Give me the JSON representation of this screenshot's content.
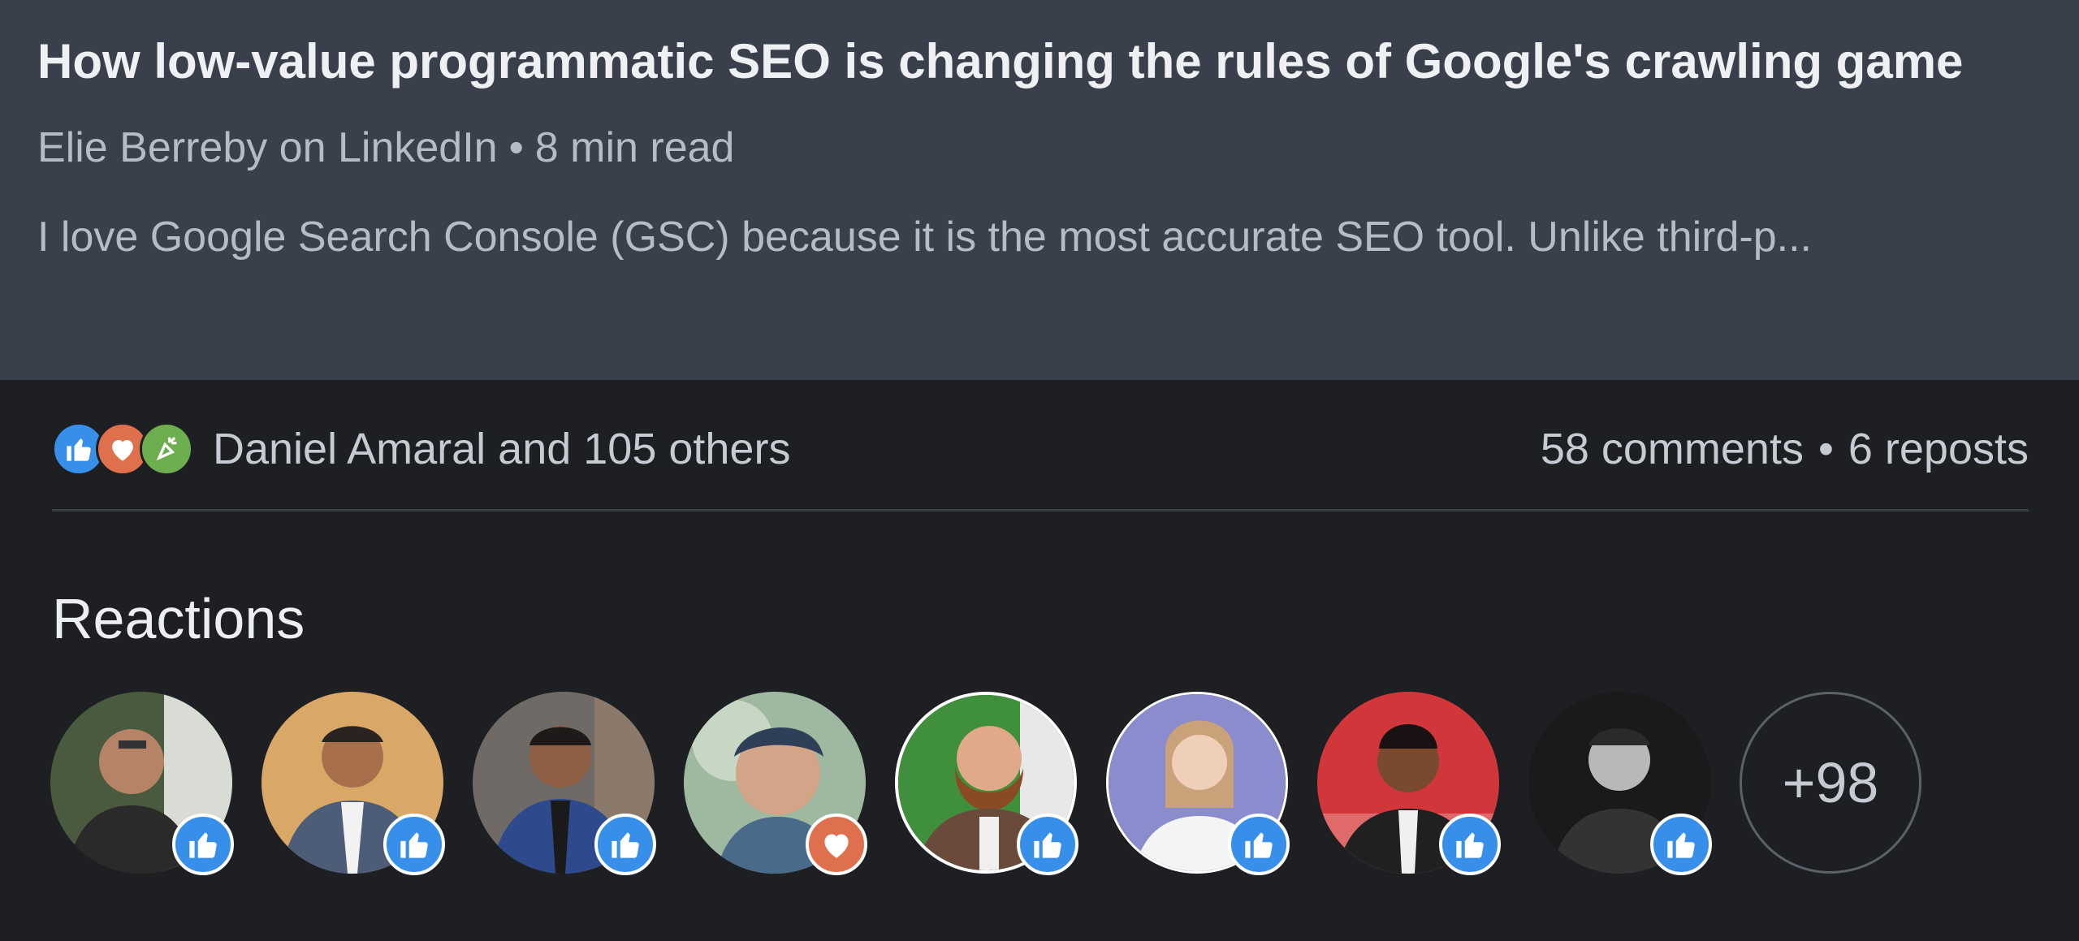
{
  "article": {
    "title": "How low-value programmatic SEO is changing the rules of Google's crawling game",
    "author_source": "Elie Berreby on LinkedIn",
    "read_time": "8 min read",
    "excerpt": "I love Google Search Console (GSC) because it is the most accurate SEO tool. Unlike third-p..."
  },
  "social": {
    "reaction_icons": [
      "like-icon",
      "love-icon",
      "celebrate-icon"
    ],
    "reactors_summary": "Daniel Amaral and 105 others",
    "comments": "58 comments",
    "reposts": "6 reposts"
  },
  "reactions": {
    "title": "Reactions",
    "more_label": "+98",
    "people": [
      {
        "reaction": "like",
        "bg": "#4a5a3e"
      },
      {
        "reaction": "like",
        "bg": "#d9a766"
      },
      {
        "reaction": "like",
        "bg": "#6f6a66"
      },
      {
        "reaction": "love",
        "bg": "#9fb9a0"
      },
      {
        "reaction": "like",
        "bg": "#3f8f3c"
      },
      {
        "reaction": "like",
        "bg": "#8a8ccd"
      },
      {
        "reaction": "like",
        "bg": "#d0363a"
      },
      {
        "reaction": "like",
        "bg": "#1a1a1a"
      }
    ]
  },
  "colors": {
    "like": "#378fe9",
    "love": "#df704d",
    "celebrate": "#6dae4f"
  }
}
